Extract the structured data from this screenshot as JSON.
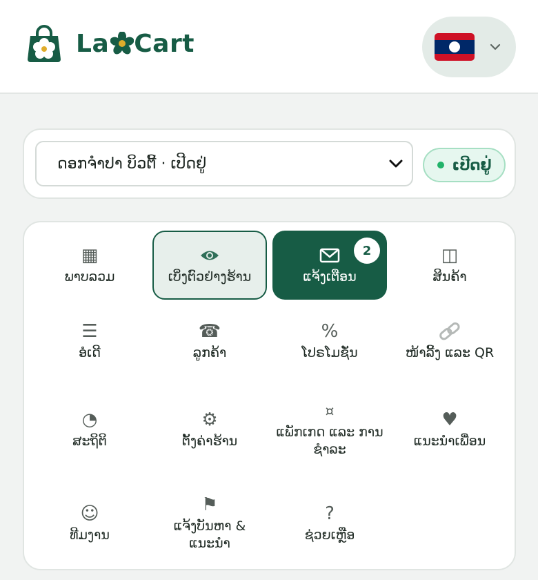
{
  "brand": {
    "name_left": "La",
    "name_right": "Cart",
    "accent": "#175c45",
    "star_color": "#e0ac2b"
  },
  "language": {
    "current": "lao-flag"
  },
  "store": {
    "selected": "ດອກຈຳປາ ບິວຕີ້ · ເປີດຢູ່",
    "status": "ເປີດຢູ່"
  },
  "menu": [
    {
      "label": "ພາບລວມ",
      "icon": "▦",
      "icon_name": "grid-icon"
    },
    {
      "label": "ເບິ່ງຕົວຢ່າງຮ້ານ",
      "icon": "👁",
      "icon_name": "eye-icon"
    },
    {
      "label": "ແຈ້ງເຕືອນ",
      "icon": "✉",
      "icon_name": "mail-icon",
      "badge": "2"
    },
    {
      "label": "ສິນຄ້າ",
      "icon": "◫",
      "icon_name": "columns-icon"
    },
    {
      "label": "ອໍເດີ",
      "icon": "☰",
      "icon_name": "list-icon"
    },
    {
      "label": "ລູກຄ້າ",
      "icon": "☎",
      "icon_name": "phone-icon"
    },
    {
      "label": "ໂປຣໂມຊັ່ນ",
      "icon": "%",
      "icon_name": "percent-icon"
    },
    {
      "label": "ໜ້າລີ້ງ ແລະ QR",
      "icon": "🔗",
      "icon_name": "link-icon"
    },
    {
      "label": "ສະຖິຕິ",
      "icon": "◔",
      "icon_name": "pie-chart-icon"
    },
    {
      "label": "ຕັ້ງຄ່າຮ້ານ",
      "icon": "⚙",
      "icon_name": "gear-icon"
    },
    {
      "label": "ແພັກເກດ ແລະ ການຊຳລະ",
      "icon": "¤",
      "icon_name": "currency-icon"
    },
    {
      "label": "ແນະນຳເພື່ອນ",
      "icon": "♥",
      "icon_name": "heart-icon"
    },
    {
      "label": "ທີມງານ",
      "icon": "☺",
      "icon_name": "smiley-icon"
    },
    {
      "label": "ແຈ້ງບັນຫາ & ແນະນຳ",
      "icon": "⚑",
      "icon_name": "flag-icon"
    },
    {
      "label": "ຊ່ວຍເຫຼືອ",
      "icon": "?",
      "icon_name": "help-icon"
    }
  ]
}
